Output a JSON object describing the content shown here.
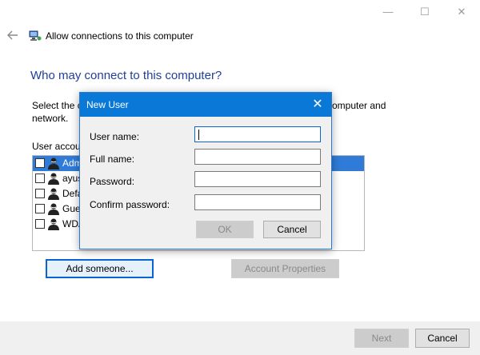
{
  "window": {
    "title": "Allow connections to this computer",
    "minimize_glyph": "—",
    "maximize_glyph": "☐",
    "close_glyph": "✕"
  },
  "heading": "Who may connect to this computer?",
  "intro_text": "Select the c                                                                                        omputer and network.",
  "intro_left": "Select the c",
  "intro_right": "omputer and",
  "intro_line2": "network.",
  "list": {
    "label": "User accou",
    "items": [
      {
        "name": "Adm",
        "selected": true,
        "checked": false
      },
      {
        "name": "ayus",
        "selected": false,
        "checked": false
      },
      {
        "name": "Defa",
        "selected": false,
        "checked": false
      },
      {
        "name": "Gues",
        "selected": false,
        "checked": false
      },
      {
        "name": "WDA",
        "selected": false,
        "checked": false
      }
    ]
  },
  "buttons": {
    "add_someone": "Add someone...",
    "account_properties": "Account Properties",
    "next": "Next",
    "cancel": "Cancel"
  },
  "dialog": {
    "title": "New User",
    "close_glyph": "✕",
    "fields": {
      "user_name_label": "User name:",
      "user_name_value": "",
      "full_name_label": "Full name:",
      "full_name_value": "",
      "password_label": "Password:",
      "password_value": "",
      "confirm_password_label": "Confirm password:",
      "confirm_password_value": ""
    },
    "ok": "OK",
    "cancel": "Cancel"
  },
  "colors": {
    "accent": "#0a78d7",
    "heading": "#1f3f9f",
    "selection": "#2f7bd7"
  },
  "icons": {
    "back": "back-arrow-icon",
    "wizard": "network-computer-icon",
    "user": "user-account-icon"
  }
}
